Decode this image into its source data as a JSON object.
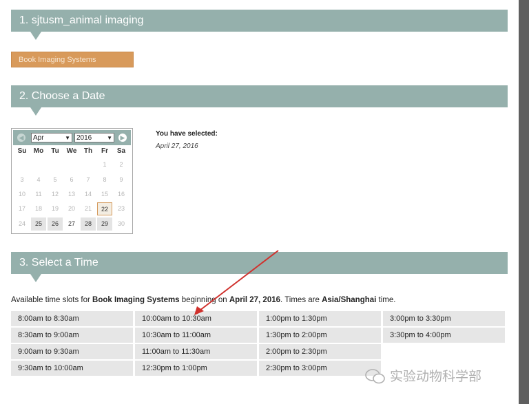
{
  "sections": {
    "s1": "1. sjtusm_animal imaging",
    "s2": "2. Choose a Date",
    "s3": "3. Select a Time"
  },
  "book_button": "Book Imaging Systems",
  "calendar": {
    "month": "Apr",
    "year": "2016",
    "weekdays": [
      "Su",
      "Mo",
      "Tu",
      "We",
      "Th",
      "Fr",
      "Sa"
    ],
    "rows": [
      [
        "",
        "",
        "",
        "",
        "",
        "1",
        "2"
      ],
      [
        "3",
        "4",
        "5",
        "6",
        "7",
        "8",
        "9"
      ],
      [
        "10",
        "11",
        "12",
        "13",
        "14",
        "15",
        "16"
      ],
      [
        "17",
        "18",
        "19",
        "20",
        "21",
        "22",
        "23"
      ],
      [
        "24",
        "25",
        "26",
        "27",
        "28",
        "29",
        "30"
      ]
    ]
  },
  "selection": {
    "label": "You have selected:",
    "date": "April 27, 2016"
  },
  "availability": {
    "prefix": "Available time slots for ",
    "service": "Book Imaging Systems",
    "mid": " beginning on ",
    "date": "April 27, 2016",
    "mid2": ". Times are ",
    "tz": "Asia/Shanghai",
    "suffix": " time."
  },
  "slots": [
    [
      "8:00am to 8:30am",
      "8:30am to 9:00am",
      "9:00am to 9:30am",
      "9:30am to 10:00am"
    ],
    [
      "10:00am to 10:30am",
      "10:30am to 11:00am",
      "11:00am to 11:30am",
      "12:30pm to 1:00pm"
    ],
    [
      "1:00pm to 1:30pm",
      "1:30pm to 2:00pm",
      "2:00pm to 2:30pm",
      "2:30pm to 3:00pm"
    ],
    [
      "3:00pm to 3:30pm",
      "3:30pm to 4:00pm"
    ]
  ],
  "watermark": "实验动物科学部",
  "colors": {
    "header": "#95b0ac",
    "button": "#d89a5b",
    "arrow": "#d0312d"
  }
}
